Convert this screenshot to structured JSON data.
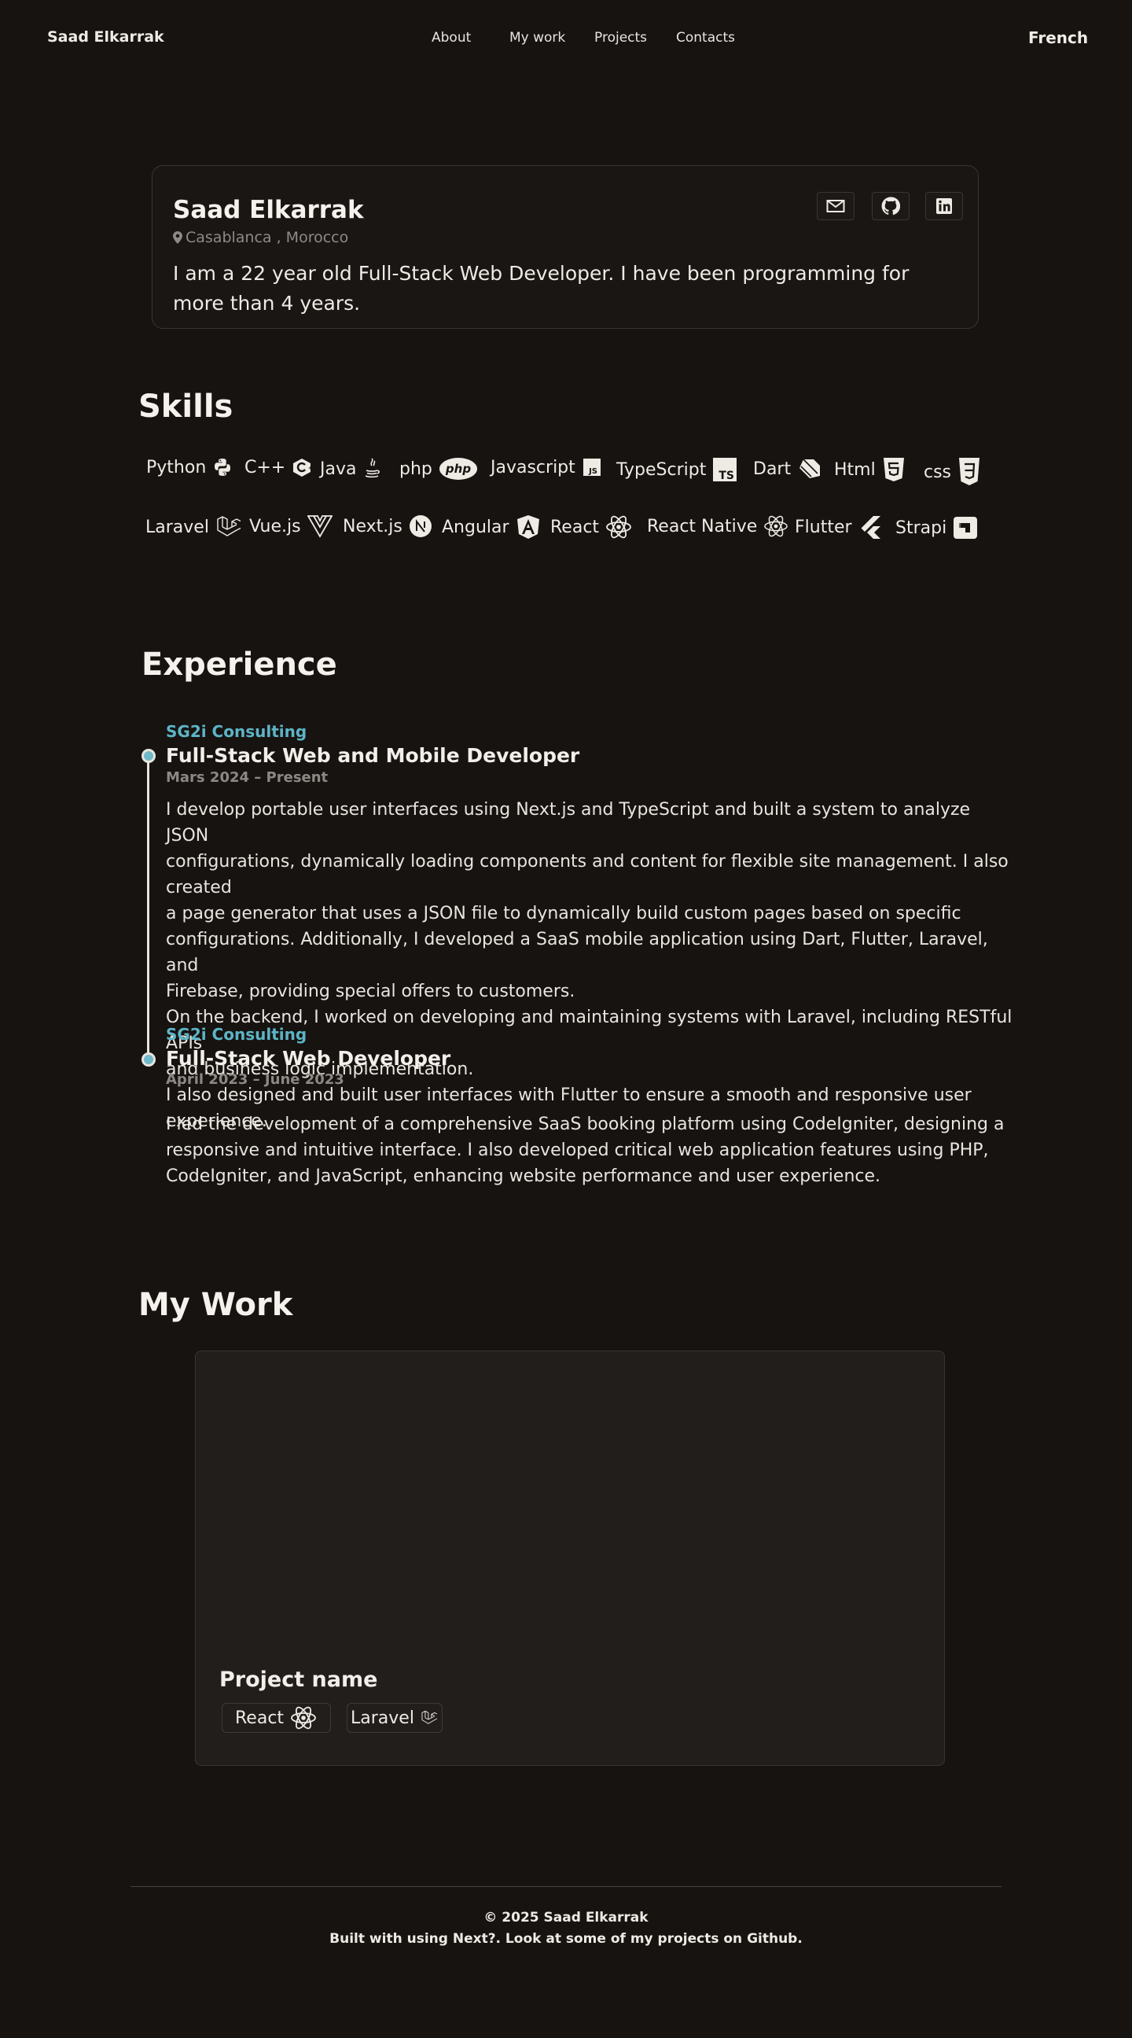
{
  "nav": {
    "brand": "Saad Elkarrak",
    "links": [
      "About",
      "My work",
      "Projects",
      "Contacts"
    ],
    "language": "French"
  },
  "profile": {
    "name": "Saad Elkarrak",
    "location": "Casablanca , Morocco",
    "bio": "I am a 22 year old Full-Stack Web Developer. I have been programming for more than 4 years.",
    "social_icons": [
      "mail-icon",
      "github-icon",
      "linkedin-icon"
    ]
  },
  "skills": {
    "title": "Skills",
    "row1": [
      "Python",
      "C++",
      "Java",
      "php",
      "Javascript",
      "TypeScript",
      "Dart",
      "Html",
      "css"
    ],
    "row2": [
      "Laravel",
      "Vue.js",
      "Next.js",
      "Angular",
      "React",
      "React Native",
      "Flutter",
      "Strapi"
    ],
    "php_badge": "php",
    "js_badge": "JS",
    "ts_badge": "TS"
  },
  "experience": {
    "title": "Experience",
    "items": [
      {
        "company": "SG2i Consulting",
        "role": "Full-Stack Web and Mobile Developer",
        "dates": "Mars 2024 – Present",
        "description": [
          "I develop portable user interfaces using Next.js and TypeScript and built a system to analyze JSON",
          "configurations, dynamically loading components and content for flexible site management. I also created",
          "a page generator that uses a JSON file to dynamically build custom pages based on specific",
          "configurations. Additionally, I developed a SaaS mobile application using Dart, Flutter, Laravel, and",
          "Firebase, providing special offers to customers.",
          "On the backend, I worked on developing and maintaining systems with Laravel, including RESTful APIs",
          "and business logic implementation.",
          "I also designed and built user interfaces with Flutter to ensure a smooth and responsive user experience."
        ]
      },
      {
        "company": "SG2i Consulting",
        "role": "Full-Stack Web Developer",
        "dates": "April 2023 – June 2023",
        "description": [
          "I led the development of a comprehensive SaaS booking platform using CodeIgniter, designing a",
          "responsive and intuitive interface. I also developed critical web application features using PHP,",
          "CodeIgniter, and JavaScript, enhancing website performance and user experience."
        ]
      }
    ]
  },
  "work": {
    "title": "My Work",
    "project": {
      "name": "Project name",
      "tags": [
        "React",
        "Laravel"
      ]
    }
  },
  "footer": {
    "copyright": "© 2025 Saad Elkarrak",
    "built_with": "Built with using Next?. Look at some of my projects on Github."
  },
  "colors": {
    "background": "#171311",
    "accent": "#5cb5c6",
    "card": "#221e1c"
  }
}
